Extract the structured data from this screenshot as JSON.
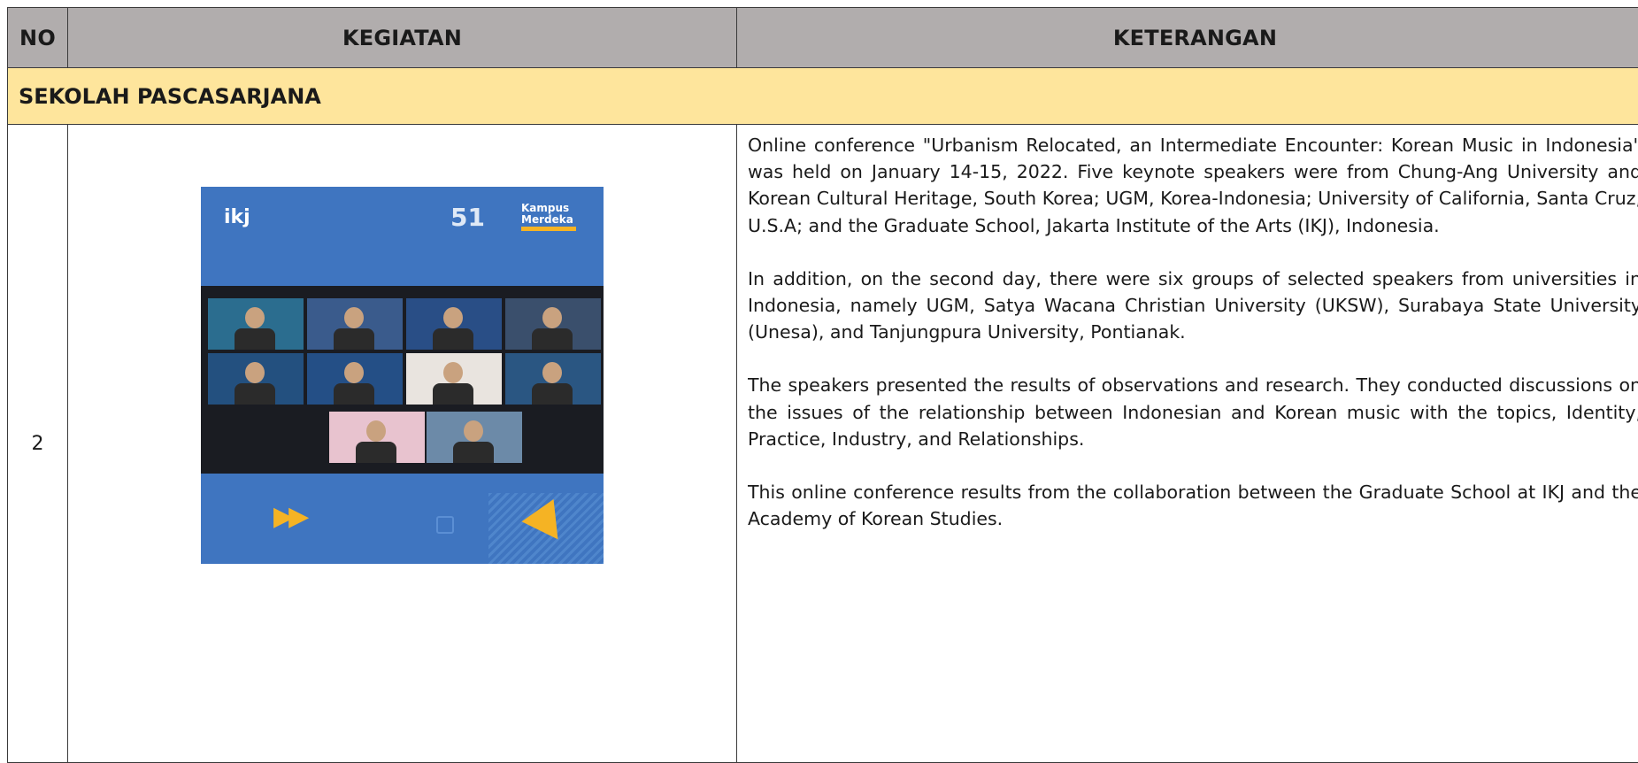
{
  "table": {
    "headers": {
      "no": "NO",
      "kegiatan": "KEGIATAN",
      "keterangan": "KETERANGAN"
    },
    "section_title": "SEKOLAH PASCASARJANA",
    "row": {
      "number": "2",
      "photo": {
        "logo_left": "ikj",
        "logo_51": "51",
        "logo_right_line1": "Kampus",
        "logo_right_line2": "Merdeka"
      },
      "paragraphs": [
        "Online conference \"Urbanism Relocated, an Intermediate Encounter: Korean Music in Indonesia\" was held on January 14-15, 2022. Five keynote speakers were from Chung-Ang University and Korean Cultural Heritage, South Korea; UGM, Korea-Indonesia; University of California, Santa Cruz, U.S.A; and the Graduate School, Jakarta Institute of the Arts (IKJ), Indonesia.",
        "In addition, on the second day, there were six groups of selected speakers from universities in Indonesia, namely UGM, Satya Wacana Christian University (UKSW), Surabaya State University (Unesa), and Tanjungpura University, Pontianak.",
        "The speakers presented the results of observations and research. They conducted discussions on the issues of the relationship between Indonesian and Korean music with the topics, Identity, Practice, Industry, and Relationships.",
        "This online conference results from the collaboration between the Graduate School at IKJ and the Academy of Korean Studies."
      ]
    }
  },
  "colors": {
    "header_bg": "#b1adad",
    "section_bg": "#fee59c",
    "photo_blue": "#3f75c0",
    "accent_orange": "#f5b324"
  }
}
